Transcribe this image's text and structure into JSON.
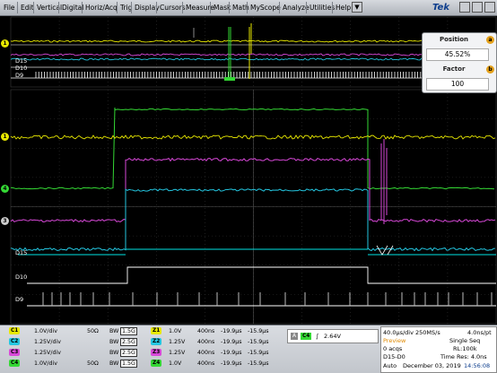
{
  "menu": {
    "items": [
      "File",
      "Edit",
      "Vertical",
      "Digital",
      "Horiz/Acq",
      "Trig",
      "Display",
      "Cursors",
      "Measure",
      "Mask",
      "Math",
      "MyScope",
      "Analyze",
      "Utilities",
      "Help"
    ],
    "logo": "Tek",
    "dropdown_glyph": "▼"
  },
  "zoom_panel": {
    "position_title": "Position",
    "position_value": "45.52%",
    "position_knob": "a",
    "factor_title": "Factor",
    "factor_value": "100",
    "factor_knob": "b"
  },
  "trace_labels": {
    "zoom": {
      "d15": "D15",
      "d10": "D10",
      "d9": "D9"
    },
    "main": {
      "d15": "D15",
      "d10": "D10",
      "d9": "D9"
    }
  },
  "channel_markers": [
    "1",
    "2",
    "3",
    "4"
  ],
  "colors": {
    "ch1": "#e8e800",
    "ch2": "#24c6e0",
    "ch3": "#d848d8",
    "ch4": "#34d834",
    "digital": "#ffffff",
    "bus_cyan": "#00e5e5"
  },
  "vertical_settings": [
    {
      "ch": "C1",
      "scale": "1.0V/div",
      "imp": "50Ω",
      "bw_label": "BW",
      "bw": "1.5G",
      "ref": "Z1",
      "zscale": "1.0V",
      "time": "400ns",
      "pos1": "-19.9μs",
      "pos2": "-15.9μs"
    },
    {
      "ch": "C2",
      "scale": "1.25V/div",
      "imp": "",
      "bw_label": "BW",
      "bw": "2.5G",
      "ref": "Z2",
      "zscale": "1.25V",
      "time": "400ns",
      "pos1": "-19.9μs",
      "pos2": "-15.9μs"
    },
    {
      "ch": "C3",
      "scale": "1.25V/div",
      "imp": "",
      "bw_label": "BW",
      "bw": "2.5G",
      "ref": "Z3",
      "zscale": "1.25V",
      "time": "400ns",
      "pos1": "-19.9μs",
      "pos2": "-15.9μs"
    },
    {
      "ch": "C4",
      "scale": "1.0V/div",
      "imp": "50Ω",
      "bw_label": "BW",
      "bw": "1.5G",
      "ref": "Z4",
      "zscale": "1.0V",
      "time": "400ns",
      "pos1": "-19.9μs",
      "pos2": "-15.9μs"
    }
  ],
  "trigger": {
    "label": "A",
    "ch": "C4",
    "slope": "∫",
    "level": "2.64V"
  },
  "acquisition": {
    "horiz": "40.0μs/div 250MS/s",
    "per_pt": "4.0ns/pt",
    "preview": "Preview",
    "mode": "Single Seq",
    "acqs": "0 acqs",
    "rl": "RL:100k",
    "bus": "D15-D0",
    "time_res": "Time Res: 4.0ns",
    "auto": "Auto",
    "date": "December 03, 2019",
    "clock": "14:56:08"
  }
}
